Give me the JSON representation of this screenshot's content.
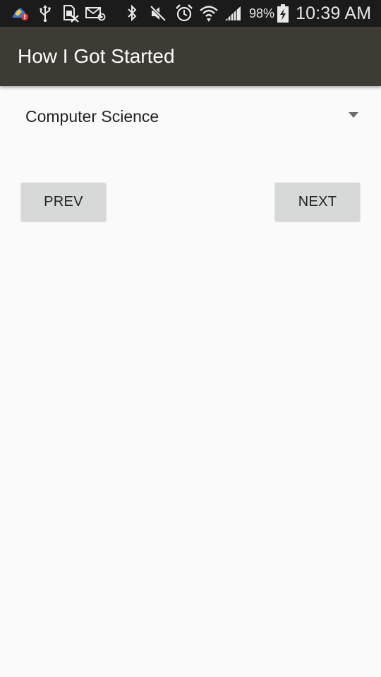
{
  "status_bar": {
    "battery_percent": "98%",
    "time": "10:39 AM",
    "icons": [
      "app-alert-icon",
      "usb-icon",
      "sim-icon",
      "email-icon",
      "bluetooth-icon",
      "mute-icon",
      "alarm-icon",
      "wifi-icon",
      "signal-icon",
      "battery-charging-icon"
    ]
  },
  "app_bar": {
    "title": "How I Got Started",
    "color": "#3e3a34"
  },
  "spinner": {
    "selected": "Computer Science"
  },
  "buttons": {
    "prev_label": "PREV",
    "next_label": "NEXT"
  }
}
